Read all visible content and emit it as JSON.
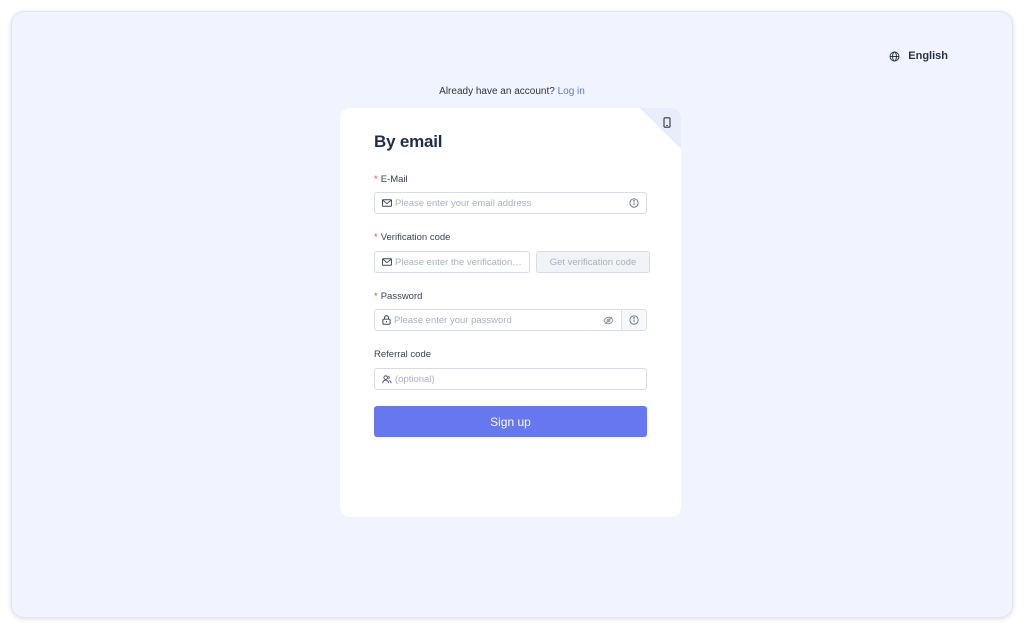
{
  "header": {
    "language_label": "English",
    "language_icon": "globe-icon"
  },
  "login_prompt": {
    "text": "Already have an account?",
    "link_label": "Log in"
  },
  "card": {
    "title": "By email",
    "corner_icon": "mobile-phone-icon",
    "email": {
      "label": "E-Mail",
      "required_mark": "*",
      "placeholder": "Please enter your email address",
      "value": "",
      "icon": "mail-icon",
      "info_icon": "info-icon"
    },
    "verification": {
      "label": "Verification code",
      "required_mark": "*",
      "placeholder": "Please enter the verification code",
      "value": "",
      "icon": "mail-icon",
      "button_label": "Get verification code"
    },
    "password": {
      "label": "Password",
      "required_mark": "*",
      "placeholder": "Please enter your password",
      "value": "",
      "icon": "lock-icon",
      "toggle_icon": "eye-off-icon",
      "info_icon": "info-icon"
    },
    "referral": {
      "label": "Referral code",
      "placeholder": "(optional)",
      "value": "",
      "icon": "user-group-icon"
    },
    "submit_label": "Sign up"
  },
  "colors": {
    "background": "#f1f3fe",
    "card": "#ffffff",
    "accent": "#6677f0",
    "link": "#5a78e6",
    "required": "#e5484d",
    "title": "#1f2d4d"
  }
}
